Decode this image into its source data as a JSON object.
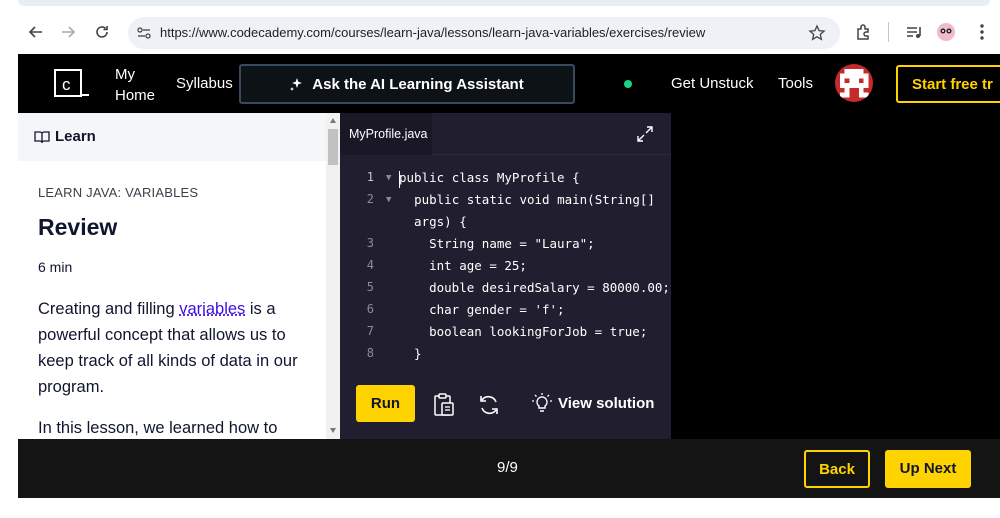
{
  "browser": {
    "url": "https://www.codecademy.com/courses/learn-java/lessons/learn-java-variables/exercises/review"
  },
  "header": {
    "nav_my_home_line1": "My",
    "nav_my_home_line2": "Home",
    "nav_syllabus": "Syllabus",
    "ai_assistant_label": "Ask the AI Learning Assistant",
    "get_unstuck": "Get Unstuck",
    "tools": "Tools",
    "trial_button": "Start free tr"
  },
  "learn_panel": {
    "header": "Learn",
    "eyebrow": "LEARN JAVA: VARIABLES",
    "title": "Review",
    "duration": "6 min",
    "para1_before": "Creating and filling ",
    "para1_link": "variables",
    "para1_after": " is a powerful concept that allows us to keep track of all kinds of data in our program.",
    "para2": "In this lesson, we learned how to"
  },
  "editor": {
    "file_tab": "MyProfile.java",
    "lines": [
      {
        "n": "1",
        "code": "public class MyProfile {"
      },
      {
        "n": "2",
        "code": "  public static void main(String[]"
      },
      {
        "n": "",
        "code": "  args) {"
      },
      {
        "n": "3",
        "code": "    String name = \"Laura\";"
      },
      {
        "n": "4",
        "code": "    int age = 25;"
      },
      {
        "n": "5",
        "code": "    double desiredSalary = 80000.00;"
      },
      {
        "n": "6",
        "code": "    char gender = 'f';"
      },
      {
        "n": "7",
        "code": "    boolean lookingForJob = true;"
      },
      {
        "n": "8",
        "code": "  }"
      }
    ],
    "run_label": "Run",
    "view_solution_label": "View solution"
  },
  "footer": {
    "progress": "9/9",
    "back_label": "Back",
    "next_label": "Up Next"
  },
  "colors": {
    "accent_yellow": "#ffd300",
    "editor_bg": "#211e2f",
    "link": "#3a10e5",
    "status_dot": "#1ad18a"
  },
  "icons": [
    "back-arrow-icon",
    "forward-arrow-icon",
    "reload-icon",
    "site-settings-icon",
    "star-icon",
    "extensions-icon",
    "media-icon",
    "profile-icon",
    "menu-dots-icon",
    "codecademy-logo",
    "sparkle-icon",
    "book-icon",
    "expand-icon",
    "clipboard-icon",
    "refresh-icon",
    "lightbulb-icon"
  ]
}
